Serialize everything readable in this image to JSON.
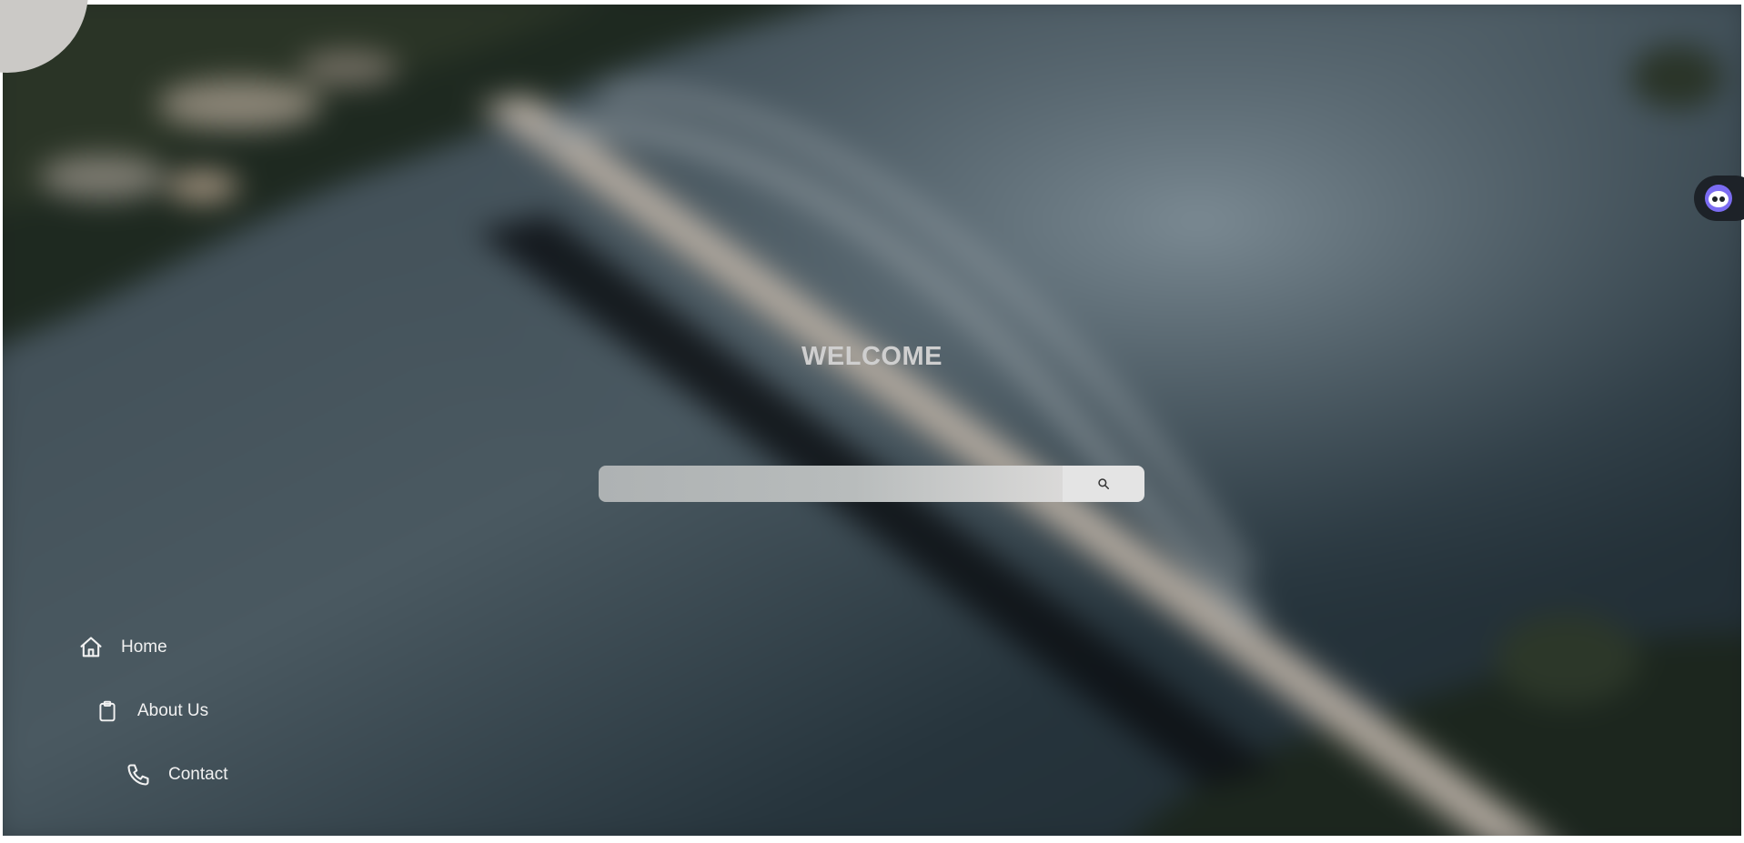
{
  "hero": {
    "title": "WELCOME"
  },
  "search": {
    "value": "",
    "placeholder": "",
    "button_icon": "search-icon"
  },
  "menu": {
    "close_icon": "close-icon",
    "items": [
      {
        "label": "Home",
        "icon": "home-icon"
      },
      {
        "label": "About Us",
        "icon": "clipboard-icon"
      },
      {
        "label": "Contact",
        "icon": "phone-icon"
      }
    ]
  },
  "assistant_widget": {
    "icon": "assistant-face-icon"
  },
  "colors": {
    "menu_circle": "#cbc9c6",
    "welcome_text": "#cfcfcf",
    "nav_text": "#f1f1f1",
    "assistant_accent": "#7b6cf2",
    "water": "#2f3b42"
  }
}
